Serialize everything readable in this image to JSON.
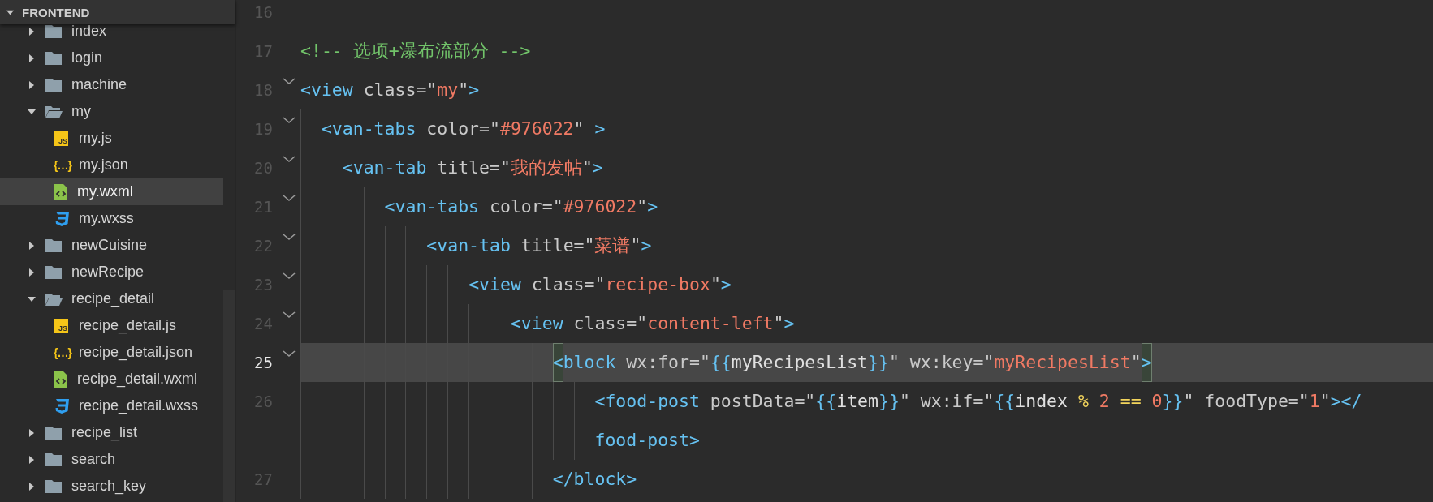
{
  "sidebar": {
    "header": {
      "title": "FRONTEND",
      "expanded": true
    },
    "items": [
      {
        "kind": "folder",
        "label": "index",
        "expanded": false,
        "selected": false
      },
      {
        "kind": "folder",
        "label": "login",
        "expanded": false,
        "selected": false
      },
      {
        "kind": "folder",
        "label": "machine",
        "expanded": false,
        "selected": false
      },
      {
        "kind": "folder",
        "label": "my",
        "expanded": true,
        "selected": false,
        "children": [
          {
            "kind": "js",
            "icon_label": "JS",
            "label": "my.js",
            "selected": false
          },
          {
            "kind": "json",
            "icon_label": "{…}",
            "label": "my.json",
            "selected": false
          },
          {
            "kind": "wxml",
            "label": "my.wxml",
            "selected": true
          },
          {
            "kind": "wxss",
            "label": "my.wxss",
            "selected": false
          }
        ]
      },
      {
        "kind": "folder",
        "label": "newCuisine",
        "expanded": false,
        "selected": false
      },
      {
        "kind": "folder",
        "label": "newRecipe",
        "expanded": false,
        "selected": false
      },
      {
        "kind": "folder",
        "label": "recipe_detail",
        "expanded": true,
        "selected": false,
        "children": [
          {
            "kind": "js",
            "icon_label": "JS",
            "label": "recipe_detail.js",
            "selected": false
          },
          {
            "kind": "json",
            "icon_label": "{…}",
            "label": "recipe_detail.json",
            "selected": false
          },
          {
            "kind": "wxml",
            "label": "recipe_detail.wxml",
            "selected": false
          },
          {
            "kind": "wxss",
            "label": "recipe_detail.wxss",
            "selected": false
          }
        ]
      },
      {
        "kind": "folder",
        "label": "recipe_list",
        "expanded": false,
        "selected": false
      },
      {
        "kind": "folder",
        "label": "search",
        "expanded": false,
        "selected": false
      },
      {
        "kind": "folder",
        "label": "search_key",
        "expanded": false,
        "selected": false
      }
    ]
  },
  "editor": {
    "lines": [
      {
        "number": "16",
        "foldable": false,
        "active": false
      },
      {
        "number": "17",
        "foldable": false,
        "active": false,
        "tokens": [
          {
            "kind": "comment",
            "text": "<!-- 选项+瀑布流部分 -->"
          }
        ]
      },
      {
        "number": "18",
        "foldable": true,
        "active": false,
        "tokens": [
          {
            "kind": "tag",
            "text": "<view"
          },
          {
            "kind": "attr",
            "text": " class=\""
          },
          {
            "kind": "str",
            "text": "my"
          },
          {
            "kind": "attr",
            "text": "\""
          },
          {
            "kind": "tag",
            "text": ">"
          }
        ]
      },
      {
        "number": "19",
        "foldable": true,
        "active": false,
        "tokens": [
          {
            "kind": "tag",
            "text": "  <van-tabs"
          },
          {
            "kind": "attr",
            "text": " color=\""
          },
          {
            "kind": "str",
            "text": "#976022"
          },
          {
            "kind": "attr",
            "text": "\" "
          },
          {
            "kind": "tag",
            "text": ">"
          }
        ]
      },
      {
        "number": "20",
        "foldable": true,
        "active": false,
        "tokens": [
          {
            "kind": "tag",
            "text": "    <van-tab"
          },
          {
            "kind": "attr",
            "text": " title=\""
          },
          {
            "kind": "str",
            "text": "我的发帖"
          },
          {
            "kind": "attr",
            "text": "\""
          },
          {
            "kind": "tag",
            "text": ">"
          }
        ]
      },
      {
        "number": "21",
        "foldable": true,
        "active": false,
        "tokens": [
          {
            "kind": "tag",
            "text": "        <van-tabs"
          },
          {
            "kind": "attr",
            "text": " color=\""
          },
          {
            "kind": "str",
            "text": "#976022"
          },
          {
            "kind": "attr",
            "text": "\""
          },
          {
            "kind": "tag",
            "text": ">"
          }
        ]
      },
      {
        "number": "22",
        "foldable": true,
        "active": false,
        "tokens": [
          {
            "kind": "tag",
            "text": "            <van-tab"
          },
          {
            "kind": "attr",
            "text": " title=\""
          },
          {
            "kind": "str",
            "text": "菜谱"
          },
          {
            "kind": "attr",
            "text": "\""
          },
          {
            "kind": "tag",
            "text": ">"
          }
        ]
      },
      {
        "number": "23",
        "foldable": true,
        "active": false,
        "tokens": [
          {
            "kind": "tag",
            "text": "                <view"
          },
          {
            "kind": "attr",
            "text": " class=\""
          },
          {
            "kind": "str",
            "text": "recipe-box"
          },
          {
            "kind": "attr",
            "text": "\""
          },
          {
            "kind": "tag",
            "text": ">"
          }
        ]
      },
      {
        "number": "24",
        "foldable": true,
        "active": false,
        "tokens": [
          {
            "kind": "tag",
            "text": "                    <view"
          },
          {
            "kind": "attr",
            "text": " class=\""
          },
          {
            "kind": "str",
            "text": "content-left"
          },
          {
            "kind": "attr",
            "text": "\""
          },
          {
            "kind": "tag",
            "text": ">"
          }
        ]
      },
      {
        "number": "25",
        "foldable": true,
        "active": true,
        "bracket_match": true,
        "tokens": [
          {
            "kind": "tag",
            "text": "                        <"
          },
          {
            "kind": "tag",
            "text": "block"
          },
          {
            "kind": "attr",
            "text": " wx:for=\""
          },
          {
            "kind": "tag",
            "text": "{{"
          },
          {
            "kind": "text",
            "text": "myRecipesList"
          },
          {
            "kind": "tag",
            "text": "}}"
          },
          {
            "kind": "attr",
            "text": "\" wx:key=\""
          },
          {
            "kind": "str",
            "text": "myRecipesList"
          },
          {
            "kind": "attr",
            "text": "\""
          },
          {
            "kind": "tag",
            "text": ">"
          }
        ]
      },
      {
        "number": "26",
        "foldable": false,
        "active": false,
        "tokens": [
          {
            "kind": "tag",
            "text": "                            <food-post"
          },
          {
            "kind": "attr",
            "text": " postData=\""
          },
          {
            "kind": "tag",
            "text": "{{"
          },
          {
            "kind": "text",
            "text": "item"
          },
          {
            "kind": "tag",
            "text": "}}"
          },
          {
            "kind": "attr",
            "text": "\" wx:if=\""
          },
          {
            "kind": "tag",
            "text": "{{"
          },
          {
            "kind": "text",
            "text": "index "
          },
          {
            "kind": "op",
            "text": "% "
          },
          {
            "kind": "num",
            "text": "2 "
          },
          {
            "kind": "op",
            "text": "== "
          },
          {
            "kind": "num",
            "text": "0"
          },
          {
            "kind": "tag",
            "text": "}}"
          },
          {
            "kind": "attr",
            "text": "\" foodType=\""
          },
          {
            "kind": "str",
            "text": "1"
          },
          {
            "kind": "attr",
            "text": "\""
          },
          {
            "kind": "tag",
            "text": "></"
          }
        ],
        "wrap_tokens": [
          {
            "kind": "tag",
            "text": "                            food-post>"
          }
        ]
      },
      {
        "number": "27",
        "foldable": false,
        "active": false,
        "tokens": [
          {
            "kind": "tag",
            "text": "                        </block>"
          }
        ]
      }
    ]
  }
}
